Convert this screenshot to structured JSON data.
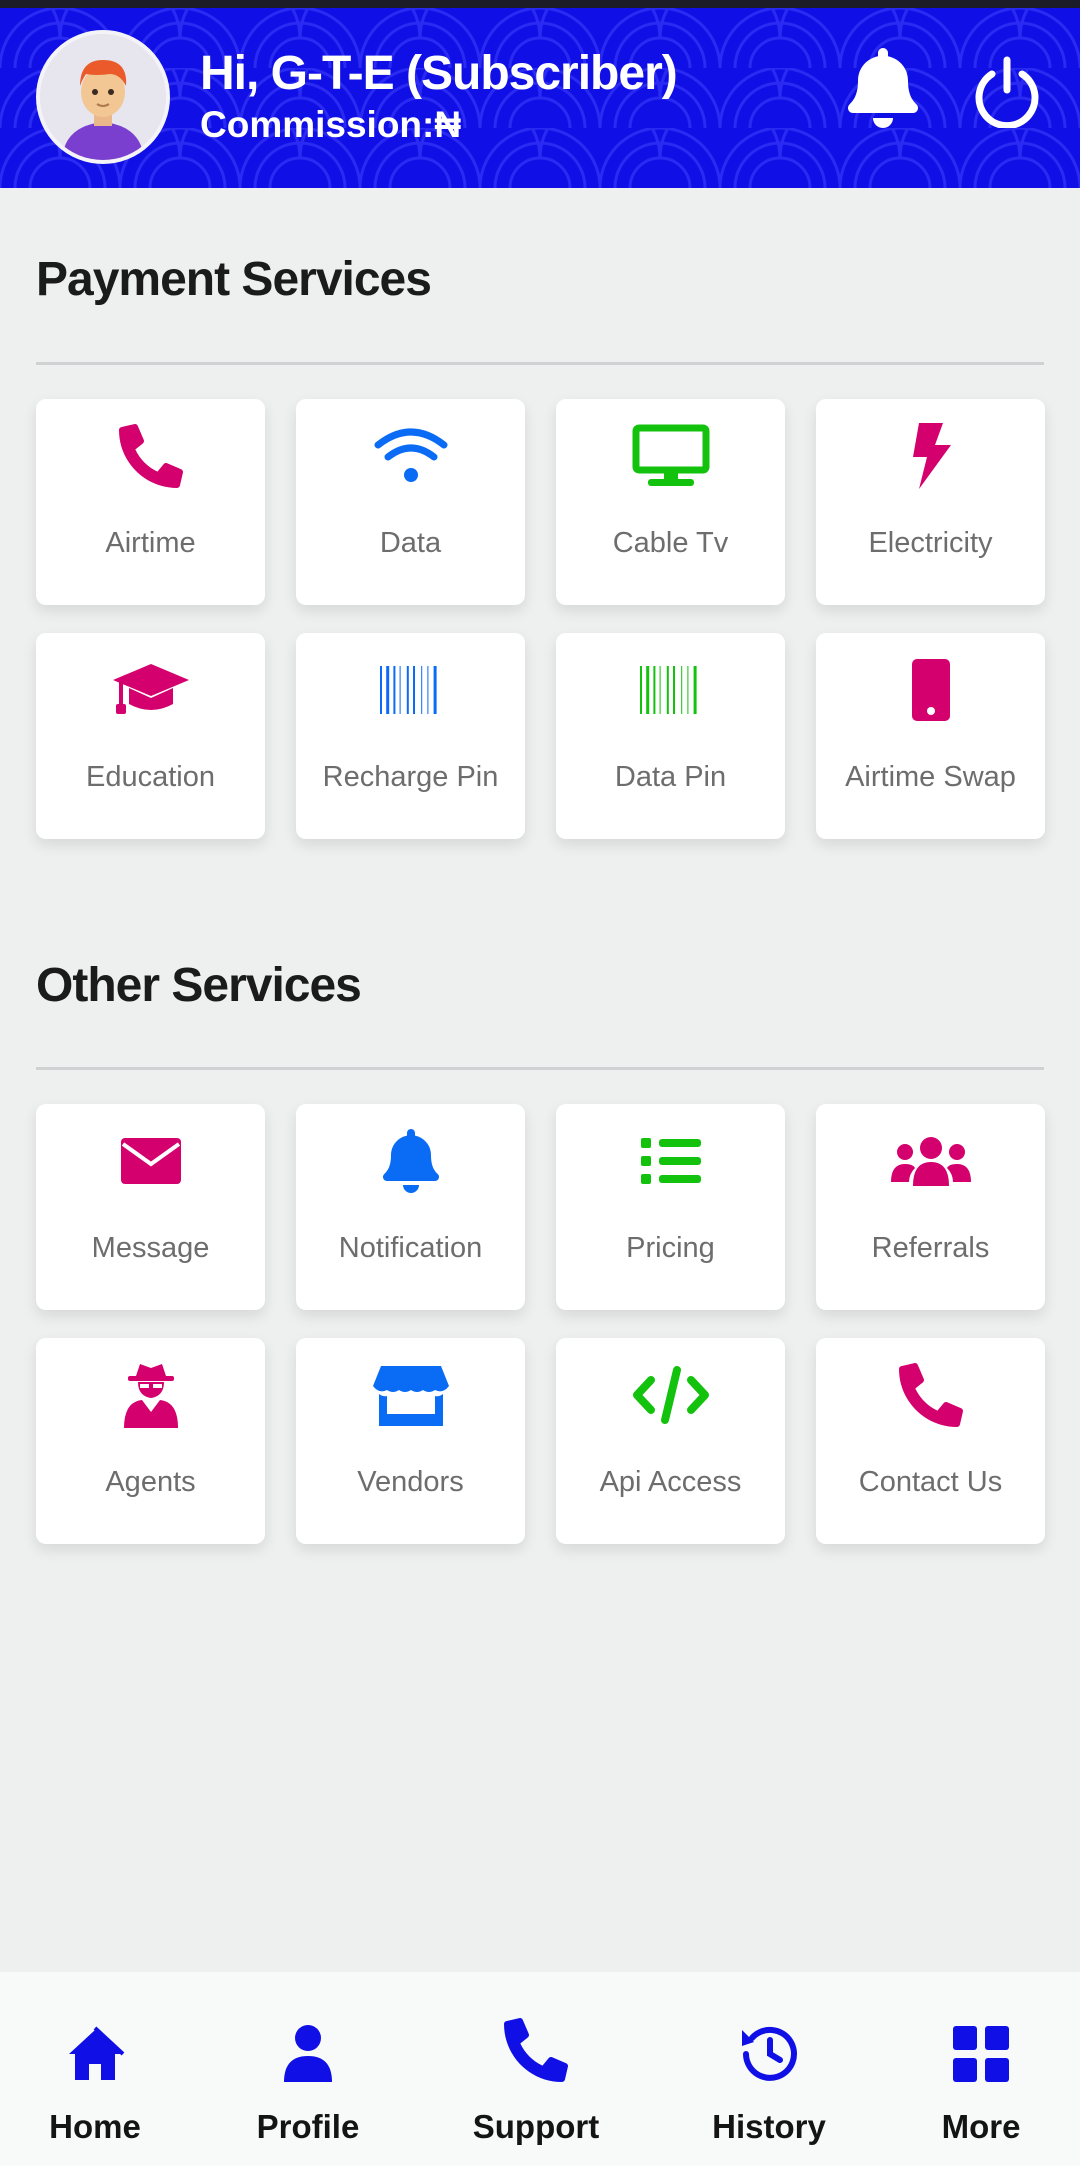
{
  "header": {
    "greeting": "Hi, G-T-E (Subscriber)",
    "commission": "Commission:₦",
    "bg_color": "#1010e6"
  },
  "payment_section": {
    "title": "Payment Services",
    "items": [
      {
        "label": "Airtime",
        "icon": "phone-icon",
        "color": "#d4006e"
      },
      {
        "label": "Data",
        "icon": "wifi-icon",
        "color": "#0a6cf5"
      },
      {
        "label": "Cable Tv",
        "icon": "tv-icon",
        "color": "#13c20d"
      },
      {
        "label": "Electricity",
        "icon": "bolt-icon",
        "color": "#d4006e"
      },
      {
        "label": "Education",
        "icon": "graduation-cap-icon",
        "color": "#d4006e"
      },
      {
        "label": "Recharge Pin",
        "icon": "barcode-icon",
        "color": "#0a6cf5"
      },
      {
        "label": "Data Pin",
        "icon": "barcode-icon",
        "color": "#13c20d"
      },
      {
        "label": "Airtime Swap",
        "icon": "mobile-icon",
        "color": "#d4006e"
      }
    ]
  },
  "other_section": {
    "title": "Other Services",
    "items": [
      {
        "label": "Message",
        "icon": "envelope-icon",
        "color": "#d4006e"
      },
      {
        "label": "Notification",
        "icon": "bell-icon",
        "color": "#0a6cf5"
      },
      {
        "label": "Pricing",
        "icon": "list-icon",
        "color": "#13c20d"
      },
      {
        "label": "Referrals",
        "icon": "users-icon",
        "color": "#d4006e"
      },
      {
        "label": "Agents",
        "icon": "user-secret-icon",
        "color": "#d4006e"
      },
      {
        "label": "Vendors",
        "icon": "store-icon",
        "color": "#0a6cf5"
      },
      {
        "label": "Api Access",
        "icon": "code-icon",
        "color": "#13c20d"
      },
      {
        "label": "Contact Us",
        "icon": "phone-icon",
        "color": "#d4006e"
      }
    ]
  },
  "bottom_nav": {
    "items": [
      {
        "label": "Home",
        "icon": "home-icon"
      },
      {
        "label": "Profile",
        "icon": "user-icon"
      },
      {
        "label": "Support",
        "icon": "phone-icon"
      },
      {
        "label": "History",
        "icon": "history-icon"
      },
      {
        "label": "More",
        "icon": "grid-icon"
      }
    ],
    "icon_color": "#1010e6"
  }
}
